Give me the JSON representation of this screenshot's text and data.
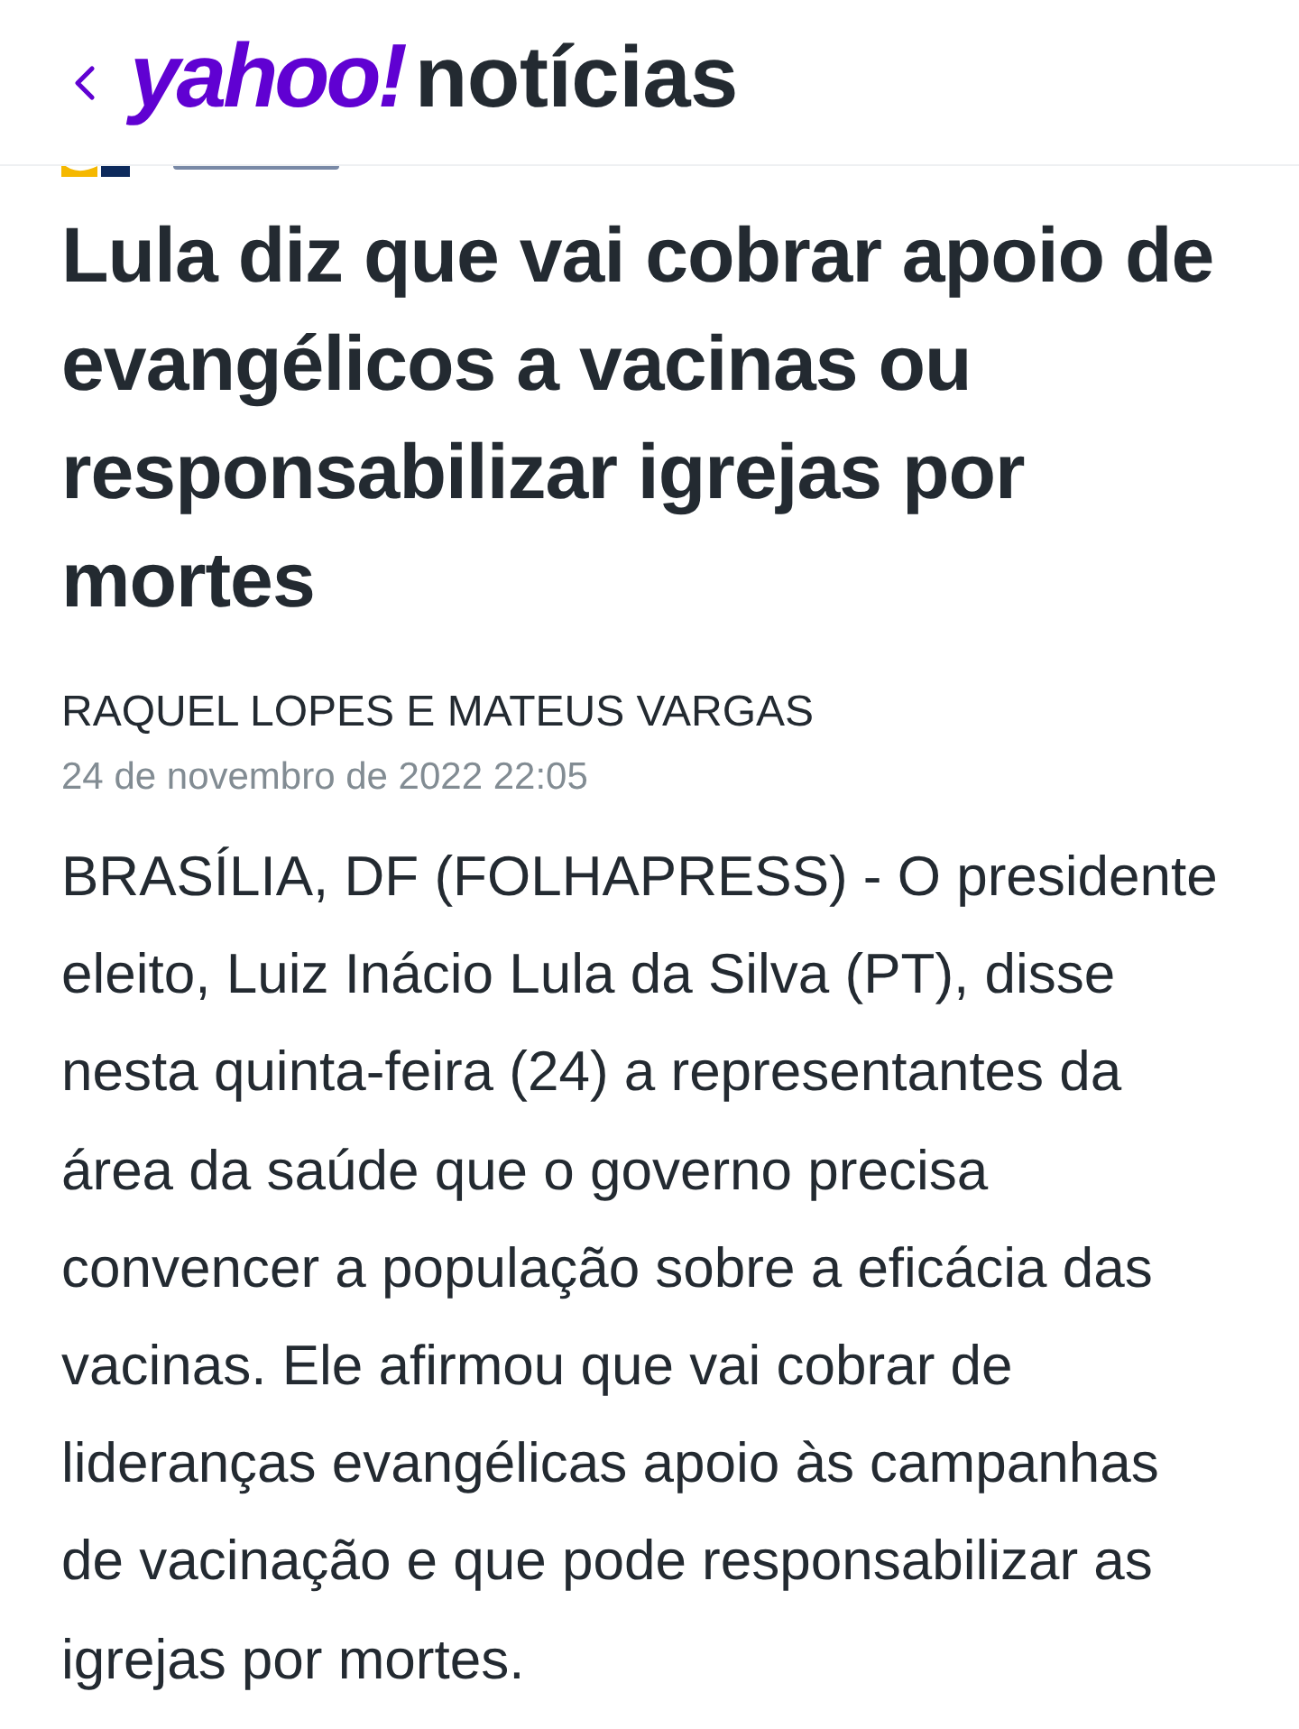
{
  "header": {
    "logo_brand": "yahoo!",
    "logo_section": "notícias"
  },
  "article": {
    "title": "Lula diz que vai cobrar apoio de evangélicos a vacinas ou responsabilizar igrejas por mortes",
    "byline": "RAQUEL LOPES E MATEUS VARGAS",
    "date": "24 de novembro de 2022 22:05",
    "paragraphs": [
      "BRASÍLIA, DF (FOLHAPRESS) - O presidente eleito, Luiz Inácio Lula da Silva (PT), disse nesta quinta-feira (24) a representantes da área da saúde que o governo precisa convencer a população sobre a eficácia das vacinas. Ele afirmou que vai cobrar de lideranças evangélicas apoio às campanhas de vacinação e que pode responsabilizar as igrejas por mortes."
    ]
  }
}
